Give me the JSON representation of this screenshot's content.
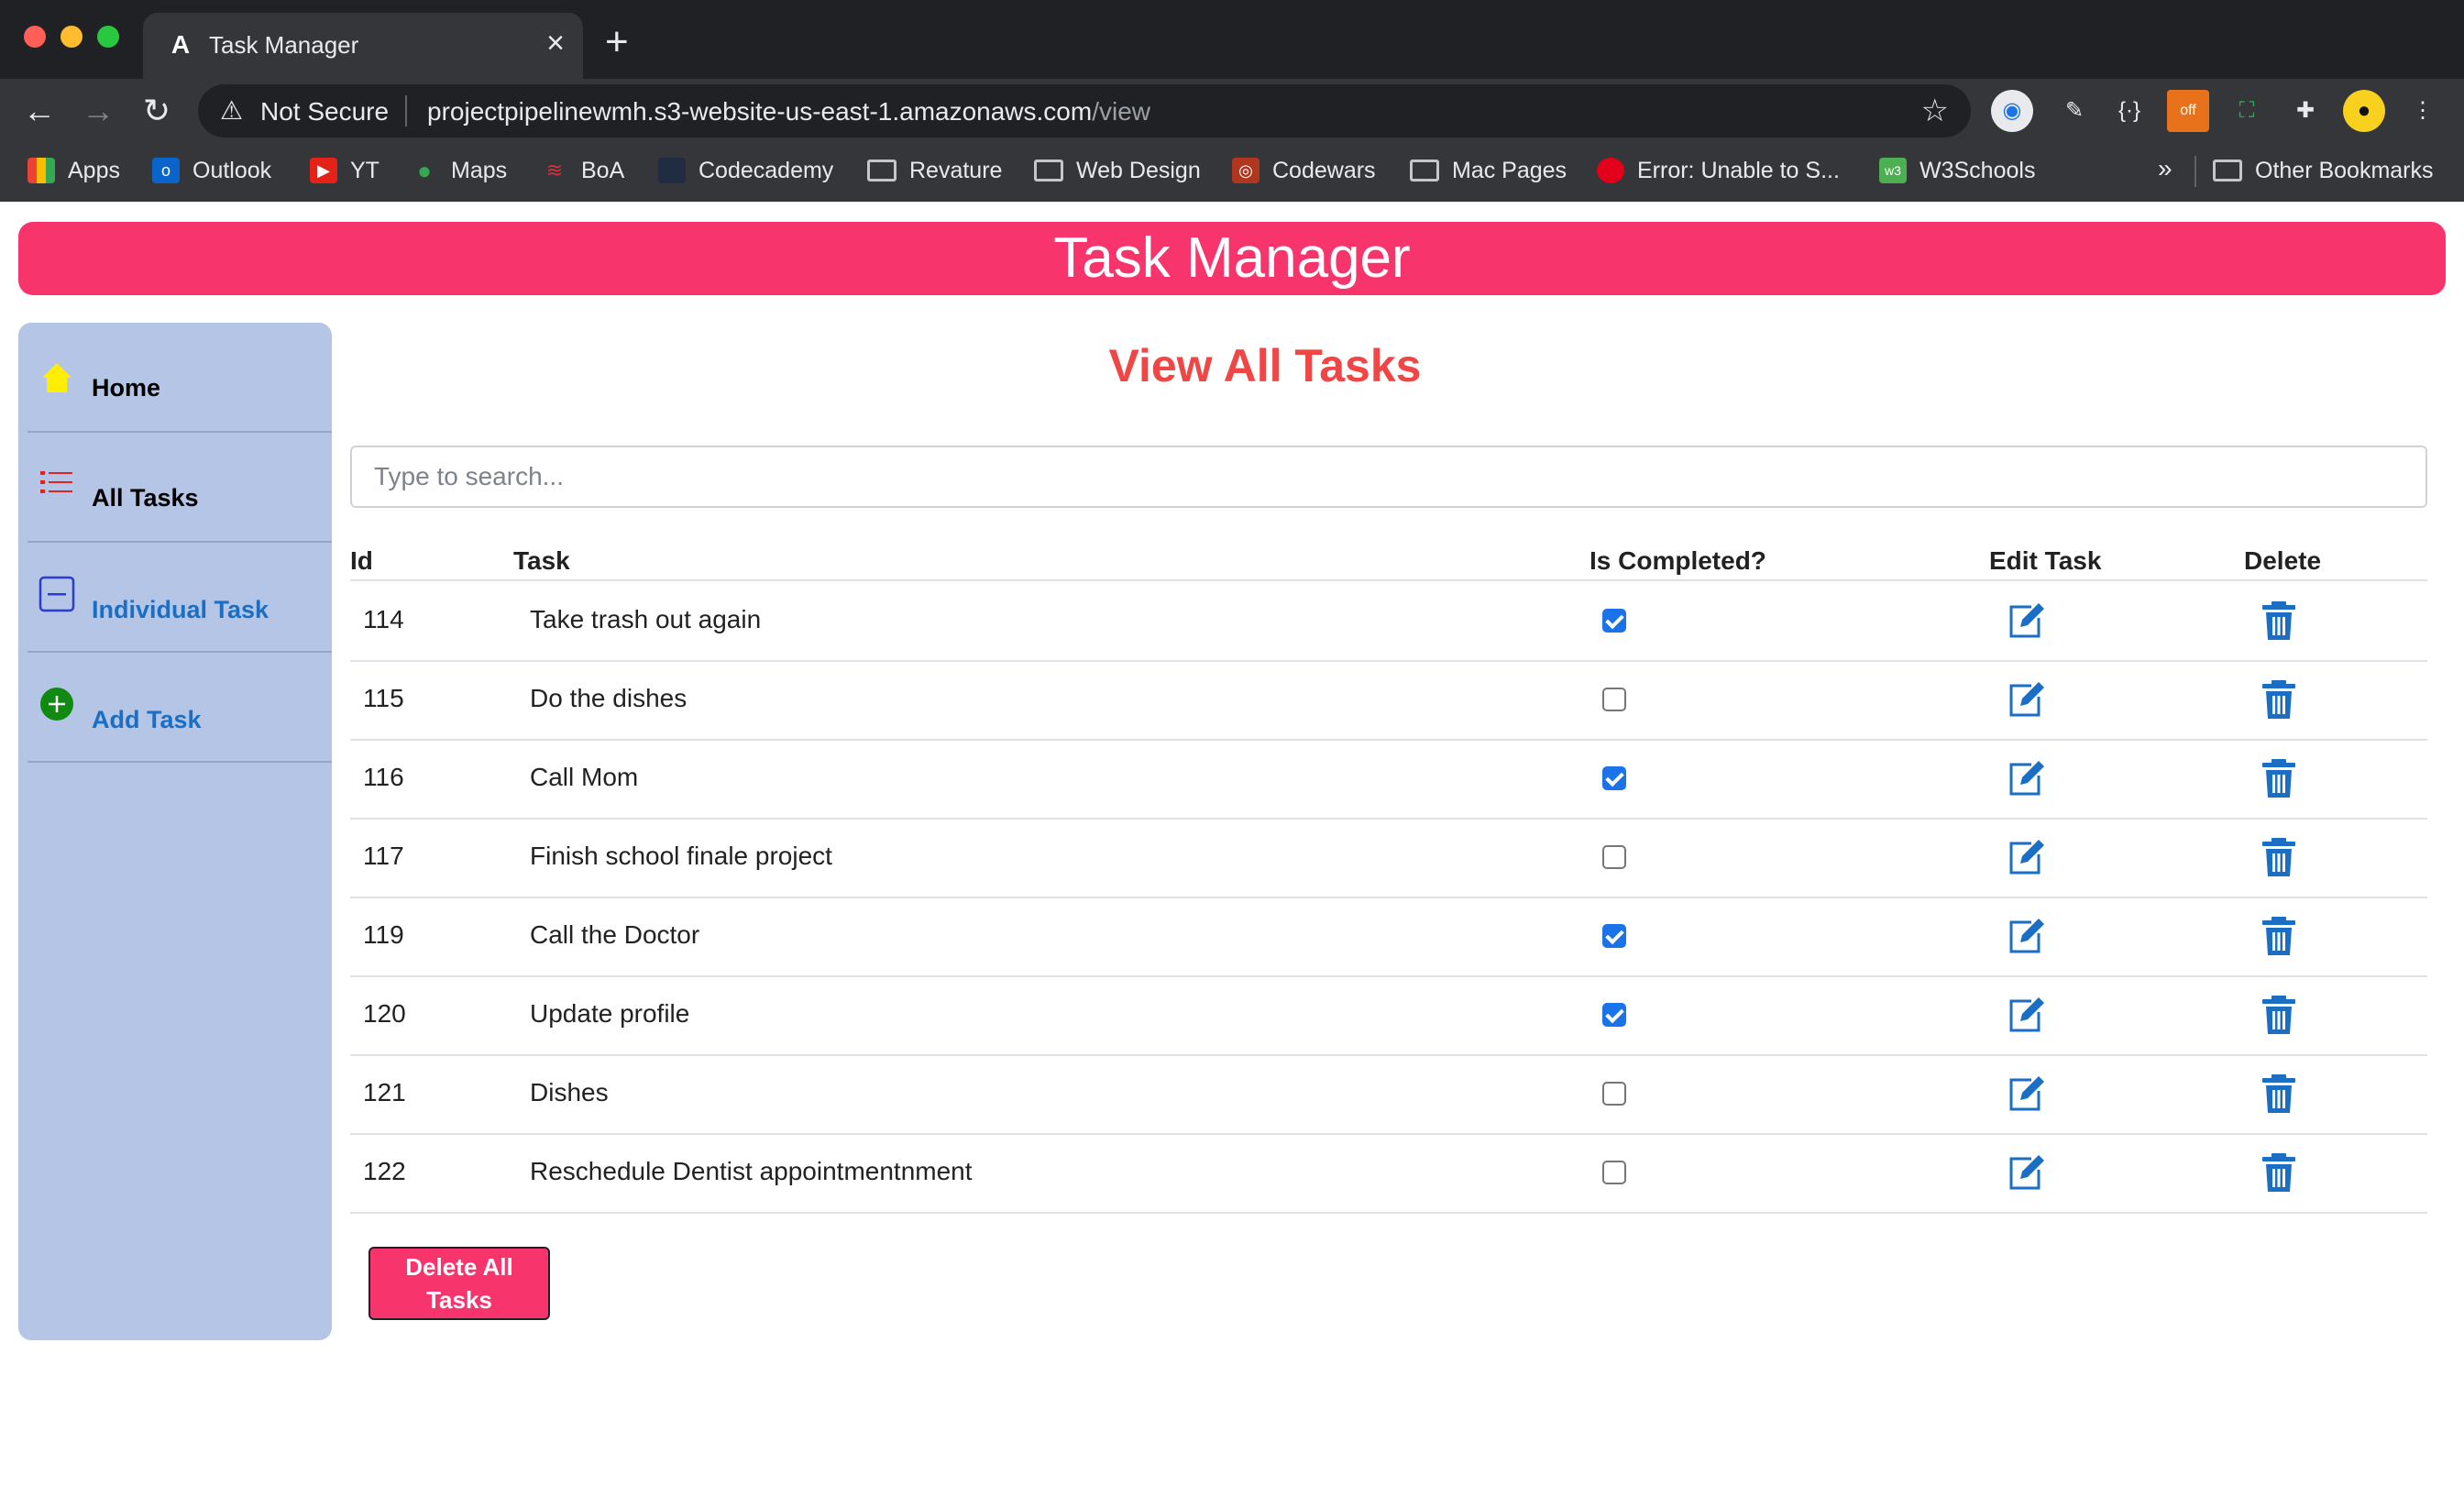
{
  "browser": {
    "tab_title": "Task Manager",
    "tab_favicon": "A",
    "new_tab_symbol": "+",
    "not_secure": "Not Secure",
    "url_host": "projectpipelinewmh.s3-website-us-east-1.amazonaws.com",
    "url_path": "/view",
    "bookmarks": [
      {
        "label": "Apps",
        "icon": "apps-grid-icon"
      },
      {
        "label": "Outlook",
        "icon": "outlook-icon"
      },
      {
        "label": "YT",
        "icon": "youtube-icon"
      },
      {
        "label": "Maps",
        "icon": "maps-pin-icon"
      },
      {
        "label": "BoA",
        "icon": "boa-icon"
      },
      {
        "label": "Codecademy",
        "icon": "codecademy-icon"
      },
      {
        "label": "Revature",
        "icon": "folder-icon"
      },
      {
        "label": "Web Design",
        "icon": "folder-icon"
      },
      {
        "label": "Codewars",
        "icon": "codewars-icon"
      },
      {
        "label": "Mac Pages",
        "icon": "folder-icon"
      },
      {
        "label": "Error: Unable to S...",
        "icon": "error-site-icon"
      },
      {
        "label": "W3Schools",
        "icon": "w3schools-icon"
      }
    ],
    "more_bookmarks": "»",
    "other_bookmarks": "Other Bookmarks"
  },
  "app": {
    "banner_title": "Task Manager",
    "page_title": "View All Tasks",
    "search_placeholder": "Type to search...",
    "delete_all_label": "Delete All Tasks"
  },
  "sidebar": {
    "items": [
      {
        "label": "Home",
        "icon": "home-icon",
        "color": "#000000"
      },
      {
        "label": "All Tasks",
        "icon": "list-icon",
        "color": "#000000"
      },
      {
        "label": "Individual Task",
        "icon": "minus-square-icon",
        "color": "#1a6fc4"
      },
      {
        "label": "Add Task",
        "icon": "plus-circle-icon",
        "color": "#1a6fc4"
      }
    ]
  },
  "table": {
    "headers": [
      "Id",
      "Task",
      "Is Completed?",
      "Edit Task",
      "Delete"
    ],
    "rows": [
      {
        "id": "114",
        "task": "Take trash out again",
        "completed": true
      },
      {
        "id": "115",
        "task": "Do the dishes",
        "completed": false
      },
      {
        "id": "116",
        "task": "Call Mom",
        "completed": true
      },
      {
        "id": "117",
        "task": "Finish school finale project",
        "completed": false
      },
      {
        "id": "119",
        "task": "Call the Doctor",
        "completed": true
      },
      {
        "id": "120",
        "task": "Update profile",
        "completed": true
      },
      {
        "id": "121",
        "task": "Dishes",
        "completed": false
      },
      {
        "id": "122",
        "task": "Reschedule Dentist appointmentnment",
        "completed": false
      }
    ]
  },
  "colors": {
    "accent_pink": "#f7346c",
    "title_red": "#f04646",
    "sidebar_bg": "#b4c5e6",
    "icon_blue": "#1a6fc4"
  }
}
